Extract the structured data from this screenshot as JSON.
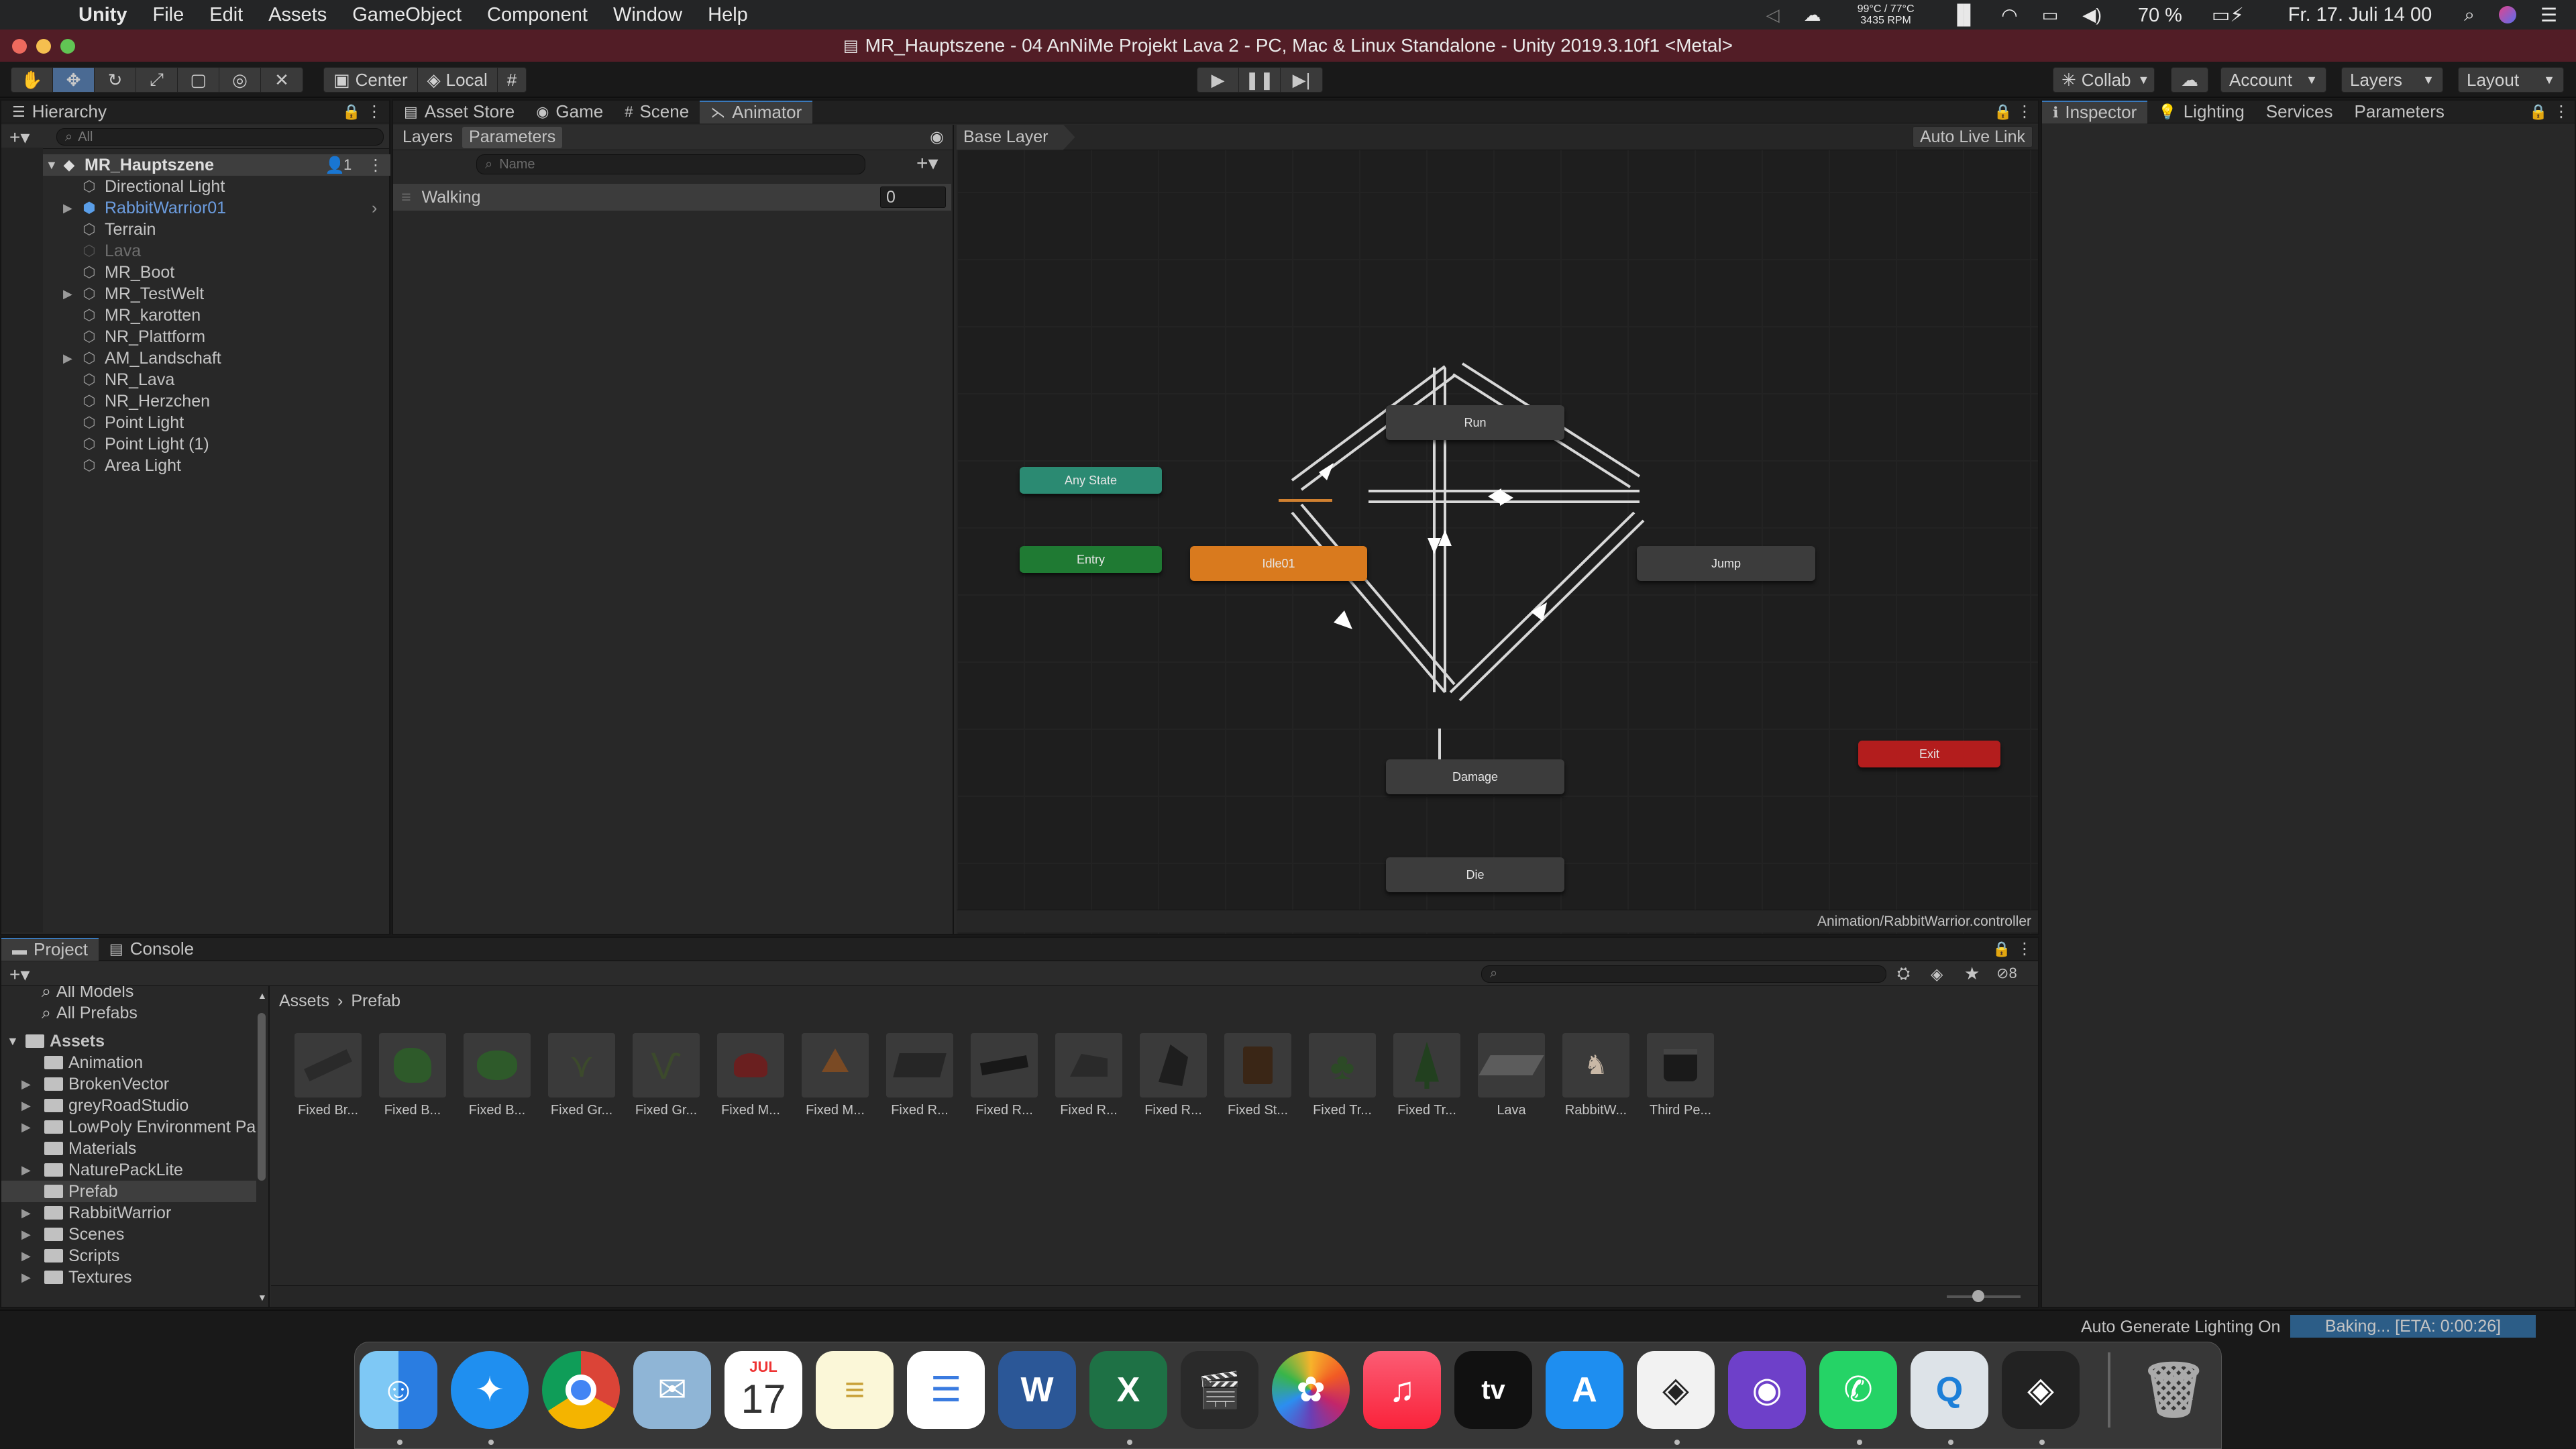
{
  "menubar": {
    "app": "Unity",
    "items": [
      "File",
      "Edit",
      "Assets",
      "GameObject",
      "Component",
      "Window",
      "Help"
    ],
    "temp": "99°C / 77°C",
    "rpm": "3435 RPM",
    "battery": "70 %",
    "clock": "Fr. 17. Juli 14 00"
  },
  "window": {
    "title": "MR_Hauptszene - 04 AnNiMe Projekt Lava 2 - PC, Mac & Linux Standalone - Unity 2019.3.10f1 <Metal>"
  },
  "toolbar": {
    "pivot": "Center",
    "space": "Local",
    "collab": "Collab",
    "account": "Account",
    "layers": "Layers",
    "layout": "Layout"
  },
  "hierarchy": {
    "tab": "Hierarchy",
    "search_placeholder": "All",
    "scene": "MR_Hauptszene",
    "scene_badge": "1",
    "items": [
      {
        "label": "Directional Light"
      },
      {
        "label": "RabbitWarrior01"
      },
      {
        "label": "Terrain"
      },
      {
        "label": "Lava"
      },
      {
        "label": "MR_Boot"
      },
      {
        "label": "MR_TestWelt"
      },
      {
        "label": "MR_karotten"
      },
      {
        "label": "NR_Plattform"
      },
      {
        "label": "AM_Landschaft"
      },
      {
        "label": "NR_Lava"
      },
      {
        "label": "NR_Herzchen"
      },
      {
        "label": "Point Light"
      },
      {
        "label": "Point Light (1)"
      },
      {
        "label": "Area Light"
      }
    ]
  },
  "center_tabs": [
    "Asset Store",
    "Game",
    "Scene",
    "Animator"
  ],
  "animator": {
    "sub_tabs": [
      "Layers",
      "Parameters"
    ],
    "name_placeholder": "Name",
    "param_name": "Walking",
    "param_value": "0",
    "breadcrumb": "Base Layer",
    "auto_live_link": "Auto Live Link",
    "controller_path": "Animation/RabbitWarrior.controller",
    "states": {
      "any": "Any State",
      "entry": "Entry",
      "idle": "Idle01",
      "run": "Run",
      "jump": "Jump",
      "damage": "Damage",
      "die": "Die",
      "exit": "Exit"
    }
  },
  "right_tabs": [
    "Inspector",
    "Lighting",
    "Services",
    "Parameters"
  ],
  "project": {
    "tabs": [
      "Project",
      "Console"
    ],
    "favorites": [
      "All Models",
      "All Prefabs"
    ],
    "root": "Assets",
    "folders": [
      "Animation",
      "BrokenVector",
      "greyRoadStudio",
      "LowPoly Environment Pa",
      "Materials",
      "NaturePackLite",
      "Prefab",
      "RabbitWarrior",
      "Scenes",
      "Scripts",
      "Textures"
    ],
    "breadcrumb_root": "Assets",
    "breadcrumb_leaf": "Prefab",
    "hidden_count": "8",
    "assets": [
      "Fixed Br...",
      "Fixed B...",
      "Fixed B...",
      "Fixed Gr...",
      "Fixed Gr...",
      "Fixed M...",
      "Fixed M...",
      "Fixed R...",
      "Fixed R...",
      "Fixed R...",
      "Fixed R...",
      "Fixed St...",
      "Fixed Tr...",
      "Fixed Tr...",
      "Lava",
      "RabbitW...",
      "Third Pe..."
    ]
  },
  "status": {
    "auto_lighting": "Auto Generate Lighting On",
    "baking": "Baking... [ETA: 0:00:26]"
  },
  "dock": [
    "Finder",
    "Safari",
    "Chrome",
    "Mail",
    "Calendar",
    "Notes",
    "Reminders",
    "Word",
    "Excel",
    "Final Cut Pro",
    "Photos",
    "Music",
    "Apple TV",
    "App Store",
    "Unity Hub",
    "GitHub Desktop",
    "WhatsApp",
    "Quicktime",
    "Unity",
    "Trash"
  ],
  "calendar": {
    "month": "JUL",
    "day": "17"
  },
  "colors": {
    "titlebar": "#521d26",
    "idle_state": "#d97a1e",
    "entry_state": "#1f7a33",
    "any_state": "#2b8a72",
    "exit_state": "#b31d1d",
    "selection": "#2c5d87"
  }
}
